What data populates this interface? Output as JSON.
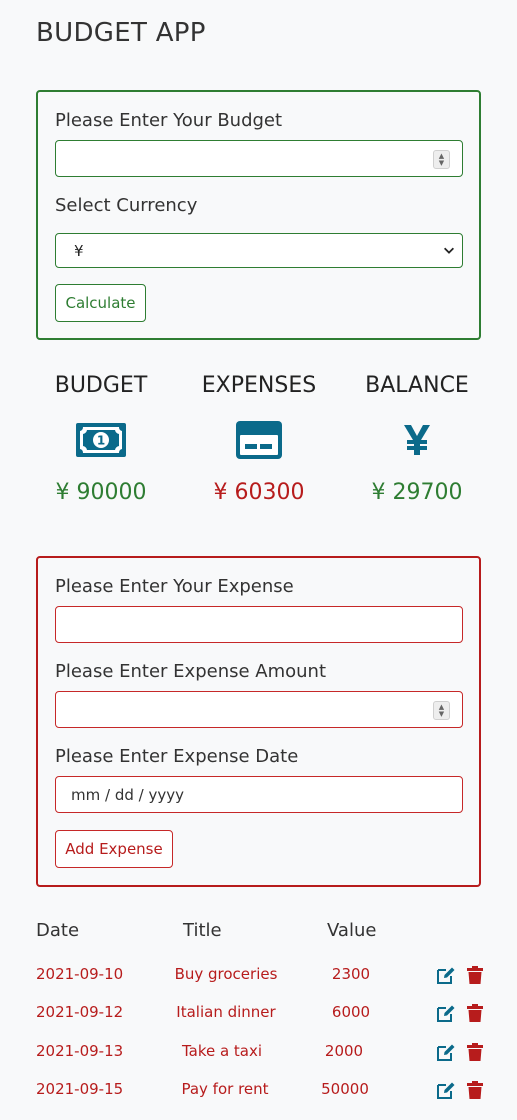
{
  "app": {
    "title": "BUDGET APP"
  },
  "budget_form": {
    "budget_label": "Please Enter Your Budget",
    "budget_value": "",
    "currency_label": "Select Currency",
    "currency_selected": "¥",
    "calculate_label": "Calculate"
  },
  "summary": {
    "budget": {
      "label": "BUDGET",
      "amount": "¥ 90000",
      "icon": "money-bill-icon"
    },
    "expenses": {
      "label": "EXPENSES",
      "amount": "¥ 60300",
      "icon": "credit-card-icon"
    },
    "balance": {
      "label": "BALANCE",
      "amount": "¥ 29700",
      "icon": "yen-sign-icon"
    }
  },
  "expense_form": {
    "title_label": "Please Enter Your Expense",
    "title_value": "",
    "amount_label": "Please Enter Expense Amount",
    "amount_value": "",
    "date_label": "Please Enter Expense Date",
    "date_placeholder": "mm / dd / yyyy",
    "add_label": "Add Expense"
  },
  "table": {
    "headers": {
      "date": "Date",
      "title": "Title",
      "value": "Value"
    },
    "rows": [
      {
        "date": "2021-09-10",
        "title": "Buy groceries",
        "value": "2300"
      },
      {
        "date": "2021-09-12",
        "title": "Italian dinner",
        "value": "6000"
      },
      {
        "date": "2021-09-13",
        "title": "Take a taxi",
        "value": "2000"
      },
      {
        "date": "2021-09-15",
        "title": "Pay for rent",
        "value": "50000"
      }
    ]
  },
  "colors": {
    "green": "#2e7d32",
    "red": "#b71c1c",
    "icon_blue": "#0b6a8a"
  }
}
